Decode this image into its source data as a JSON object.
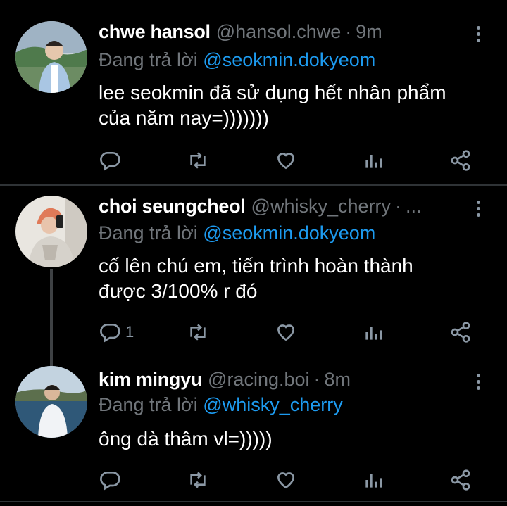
{
  "tweets": [
    {
      "name": "chwe hansol",
      "handle": "@hansol.chwe",
      "separator": "·",
      "time": "9m",
      "reply_prefix": "Đang trả lời",
      "reply_to": "@seokmin.dokyeom",
      "text_line1": "lee seokmin đã sử dụng hết nhân phẩm",
      "text_line2": "của năm nay=)))))))",
      "reply_count": "",
      "avatar_colors": [
        "#5b8a5a",
        "#a7c0d8"
      ]
    },
    {
      "name": "choi seungcheol",
      "handle": "@whisky_cherry",
      "separator": "·",
      "time": "...",
      "reply_prefix": "Đang trả lời",
      "reply_to": "@seokmin.dokyeom",
      "text_line1": "cố lên chú em, tiến trình hoàn thành",
      "text_line2": "được 3/100% r đó",
      "reply_count": "1",
      "avatar_colors": [
        "#d9d4cc",
        "#e27a5c"
      ]
    },
    {
      "name": "kim mingyu",
      "handle": "@racing.boi",
      "separator": "·",
      "time": "8m",
      "reply_prefix": "Đang trả lời",
      "reply_to": "@whisky_cherry",
      "text_line1": "ông dà thâm vl=)))))",
      "text_line2": "",
      "reply_count": "",
      "avatar_colors": [
        "#3c5f7e",
        "#e9edf2"
      ]
    }
  ],
  "icons": [
    "reply-icon",
    "retweet-icon",
    "like-icon",
    "views-icon",
    "share-icon",
    "more-icon"
  ],
  "colors": {
    "background": "#000000",
    "link": "#1d9bf0",
    "muted": "#71767b",
    "icon": "#8b98a5"
  }
}
